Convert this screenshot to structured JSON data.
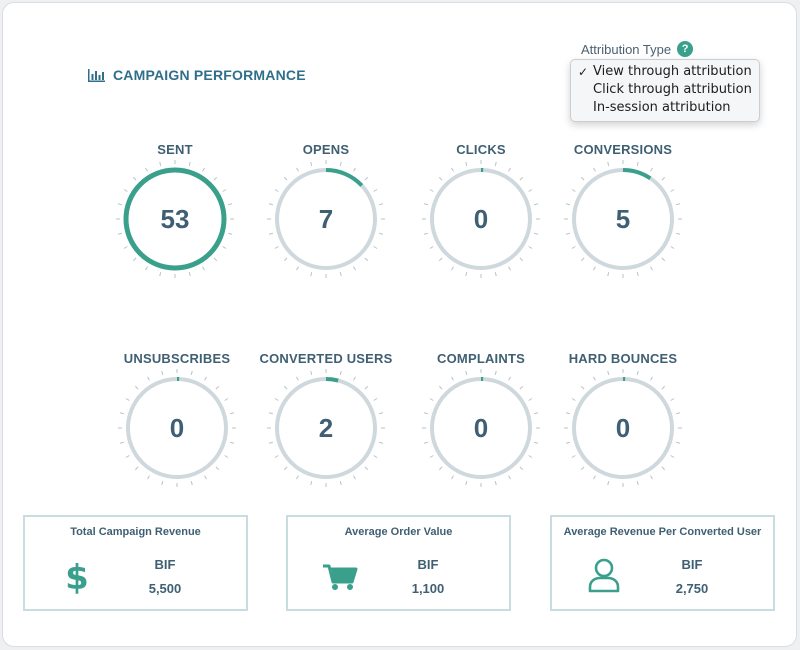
{
  "section": {
    "title": "CAMPAIGN PERFORMANCE",
    "icon": "bar-chart-icon"
  },
  "attribution": {
    "label": "Attribution Type",
    "help_icon": "?",
    "options": [
      {
        "label": "View through attribution",
        "selected": true
      },
      {
        "label": "Click through attribution",
        "selected": false
      },
      {
        "label": "In-session attribution",
        "selected": false
      }
    ],
    "check": "✓"
  },
  "colors": {
    "accent": "#3aa08c",
    "track": "#cfd8dd",
    "tick": "#b8c3c9",
    "text": "#3f5f72"
  },
  "metrics": [
    {
      "label": "SENT",
      "value": "53",
      "fraction": 1.0
    },
    {
      "label": "OPENS",
      "value": "7",
      "fraction": 0.13
    },
    {
      "label": "CLICKS",
      "value": "0",
      "fraction": 0
    },
    {
      "label": "CONVERSIONS",
      "value": "5",
      "fraction": 0.094
    },
    {
      "label": "UNSUBSCRIBES",
      "value": "0",
      "fraction": 0
    },
    {
      "label": "CONVERTED USERS",
      "value": "2",
      "fraction": 0.04
    },
    {
      "label": "COMPLAINTS",
      "value": "0",
      "fraction": 0
    },
    {
      "label": "HARD BOUNCES",
      "value": "0",
      "fraction": 0
    }
  ],
  "revenue": [
    {
      "title": "Total Campaign Revenue",
      "currency": "BIF",
      "amount": "5,500",
      "icon": "dollar-icon"
    },
    {
      "title": "Average Order Value",
      "currency": "BIF",
      "amount": "1,100",
      "icon": "shopping-cart-icon"
    },
    {
      "title": "Average Revenue Per Converted User",
      "currency": "BIF",
      "amount": "2,750",
      "icon": "user-icon"
    }
  ]
}
